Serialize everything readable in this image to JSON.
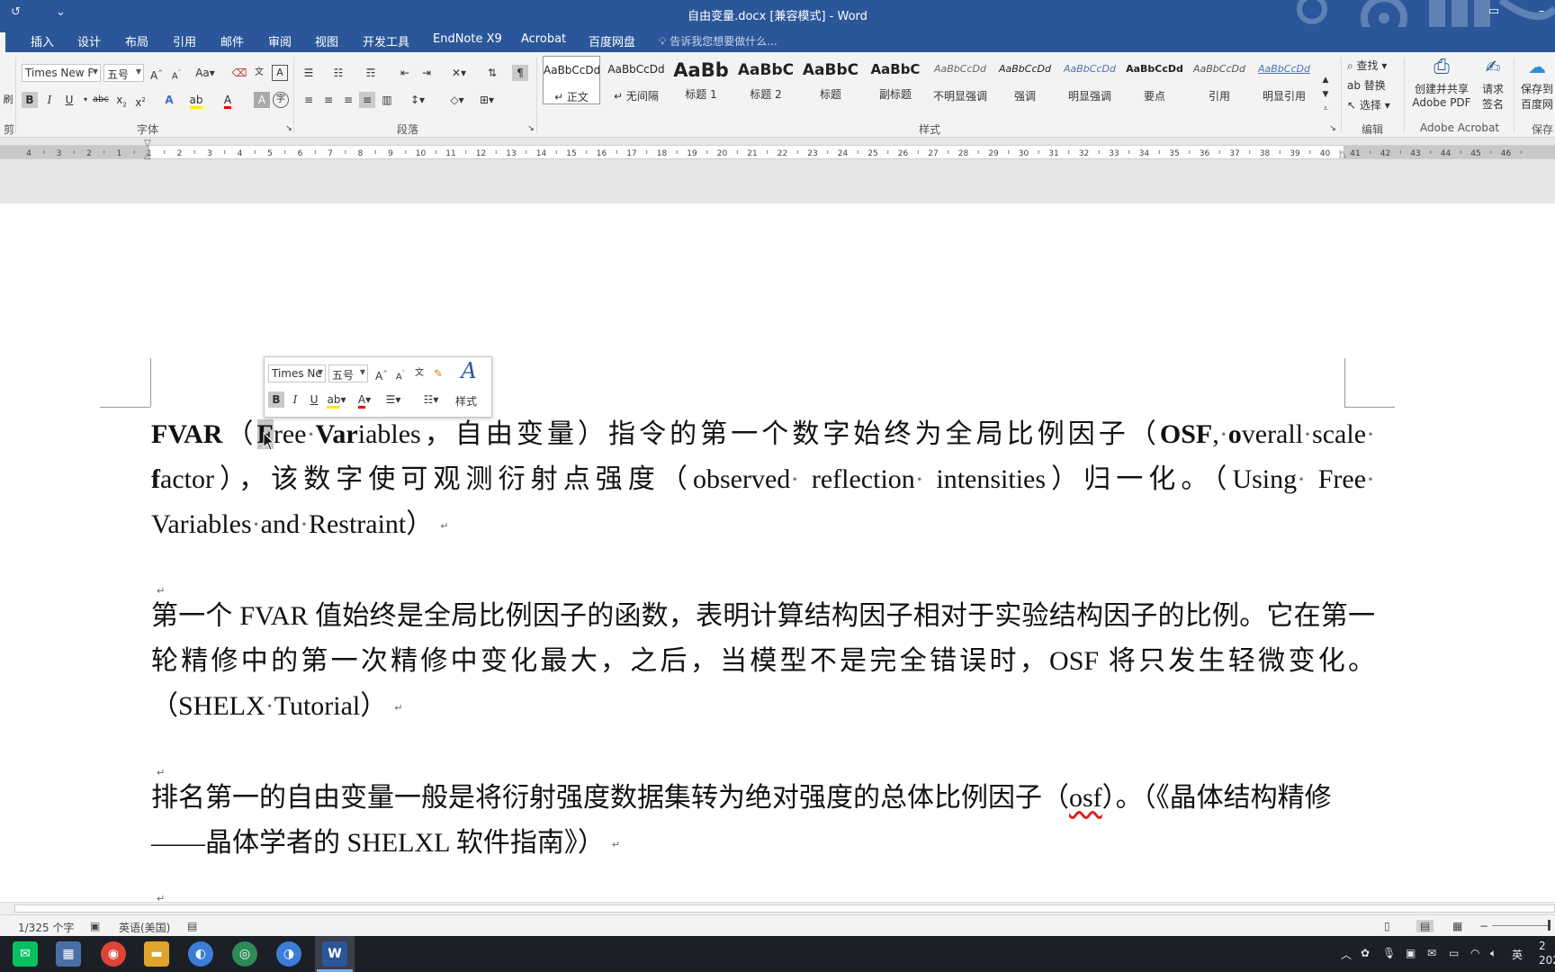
{
  "window": {
    "title": "自由变量.docx [兼容模式] - Word"
  },
  "tabs": [
    "插入",
    "设计",
    "布局",
    "引用",
    "邮件",
    "审阅",
    "视图",
    "开发工具",
    "EndNote X9",
    "Acrobat",
    "百度网盘"
  ],
  "tell_me": "告诉我您想要做什么...",
  "ribbon": {
    "font_name": "Times New F",
    "font_size": "五号",
    "group_font": "字体",
    "group_paragraph": "段落",
    "group_styles": "样式",
    "group_edit": "编辑",
    "group_acrobat": "Adobe Acrobat",
    "group_save": "保存",
    "styles": [
      {
        "sample": "AaBbCcDd",
        "name": "↵ 正文"
      },
      {
        "sample": "AaBbCcDd",
        "name": "↵ 无间隔"
      },
      {
        "sample": "AaBb",
        "name": "标题 1"
      },
      {
        "sample": "AaBbC",
        "name": "标题 2"
      },
      {
        "sample": "AaBbC",
        "name": "标题"
      },
      {
        "sample": "AaBbC",
        "name": "副标题"
      },
      {
        "sample": "AaBbCcDd",
        "name": "不明显强调"
      },
      {
        "sample": "AaBbCcDd",
        "name": "强调"
      },
      {
        "sample": "AaBbCcDd",
        "name": "明显强调"
      },
      {
        "sample": "AaBbCcDd",
        "name": "要点"
      },
      {
        "sample": "AaBbCcDd",
        "name": "引用"
      },
      {
        "sample": "AaBbCcDd",
        "name": "明显引用"
      }
    ],
    "find": "查找",
    "replace": "替换",
    "select": "选择",
    "create_pdf_1": "创建并共享",
    "create_pdf_2": "Adobe PDF",
    "request_sign_1": "请求",
    "request_sign_2": "签名",
    "save_baidu_1": "保存到",
    "save_baidu_2": "百度网"
  },
  "ruler_numbers": [
    "4",
    "3",
    "2",
    "1",
    "1",
    "2",
    "3",
    "4",
    "5",
    "6",
    "7",
    "8",
    "9",
    "10",
    "11",
    "12",
    "13",
    "14",
    "15",
    "16",
    "17",
    "18",
    "19",
    "20",
    "21",
    "22",
    "23",
    "24",
    "25",
    "26",
    "27",
    "28",
    "29",
    "30",
    "31",
    "32",
    "33",
    "34",
    "35",
    "36",
    "37",
    "38",
    "39",
    "40",
    "41",
    "42",
    "43",
    "44",
    "45",
    "46"
  ],
  "mini_toolbar": {
    "font": "Times Ne",
    "size": "五号",
    "styles_label": "样式"
  },
  "document": {
    "p1": {
      "fvar": "FVAR",
      "paren_open": "（",
      "sel_f": "F",
      "ree": "ree",
      "var": "Var",
      "iables": "iables",
      "rest": "，自由变量）指令的第一个数字始终为全局比例因子（",
      "osf": "OSF",
      "comma": ",",
      "o": "o",
      "verall": "verall",
      "scale": "scale",
      "f": "f",
      "actor": "actor），该数字使可观测衍射点强度（observed",
      "reflection": "reflection",
      "intensities": "intensities）归一化。（Using",
      "free": "Free",
      "variables": "Variables",
      "and": "and",
      "restraint": "Restraint）"
    },
    "p2": "第一个 FVAR 值始终是全局比例因子的函数，表明计算结构因子相对于实验结构因子的比例。它在第一轮精修中的第一次精修中变化最大，之后，当模型不是完全错误时，OSF  将只发生轻微变化。（SHELX",
    "p2_tail": "Tutorial）",
    "p3_a": "排名第一的自由变量一般是将衍射强度数据集转为绝对强度的总体比例因子（",
    "p3_osf": "osf",
    "p3_b": "）。（《晶体结构精修——晶体学者的 SHELXL 软件指南》）"
  },
  "status": {
    "words": "1/325 个字",
    "language": "英语(美国)"
  },
  "tray": {
    "ime": "英",
    "time": "2",
    "date": "202"
  }
}
